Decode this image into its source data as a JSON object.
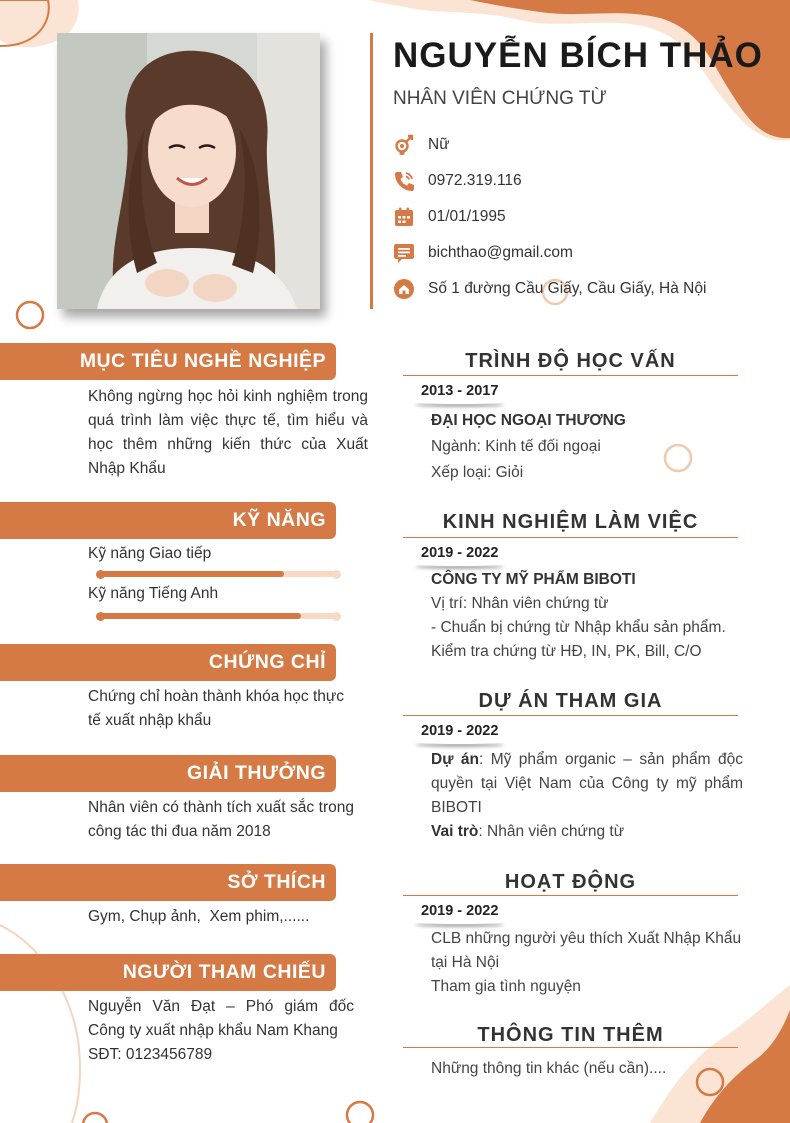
{
  "colors": {
    "accent": "#d67a45",
    "accent_light": "#f7d9c4",
    "text": "#333333"
  },
  "profile": {
    "name": "NGUYỄN BÍCH THẢO",
    "job_title": "NHÂN VIÊN CHỨNG TỪ",
    "gender": "Nữ",
    "phone": "0972.319.116",
    "birthday": "01/01/1995",
    "email": "bichthao@gmail.com",
    "address": "Số 1 đường Cầu Giấy, Cầu Giấy, Hà Nội"
  },
  "icons": [
    "gender-icon",
    "phone-icon",
    "calendar-icon",
    "email-icon",
    "location-icon"
  ],
  "left": {
    "objective": {
      "title": "MỤC TIÊU NGHỀ NGHIỆP",
      "text": "Không ngừng học hỏi kinh nghiệm trong quá trình làm việc thực tế, tìm hiểu và học thêm những kiến thức của Xuất Nhập Khẩu"
    },
    "skills": {
      "title": "KỸ NĂNG",
      "items": [
        {
          "label": "Kỹ năng Giao tiếp",
          "level": 0.78
        },
        {
          "label": "Kỹ năng Tiếng Anh",
          "level": 0.85
        }
      ]
    },
    "certificates": {
      "title": "CHỨNG CHỈ",
      "text": "Chứng chỉ hoàn thành khóa học thực tế xuất nhập khẩu"
    },
    "awards": {
      "title": "GIẢI THƯỞNG",
      "text": "Nhân viên có thành tích xuất sắc trong công tác thi đua năm 2018"
    },
    "hobbies": {
      "title": "SỞ THÍCH",
      "text": "Gym, Chụp ảnh,  Xem phim,......"
    },
    "references": {
      "title": "NGƯỜI THAM CHIẾU",
      "text": "Nguyễn Văn Đạt – Phó giám đốc Công ty xuất nhập khẩu Nam Khang",
      "phone": "SĐT: 0123456789"
    }
  },
  "right": {
    "education": {
      "title": "TRÌNH ĐỘ HỌC VẤN",
      "date": "2013 - 2017",
      "school": "ĐẠI HỌC NGOẠI THƯƠNG",
      "major": "Ngành: Kinh tế đối ngoại",
      "grade": "Xếp loại: Giỏi"
    },
    "experience": {
      "title": "KINH NGHIỆM LÀM VIỆC",
      "date": "2019 - 2022",
      "company": "CÔNG TY MỸ PHẨM BIBOTI",
      "position": "Vị trí: Nhân viên chứng từ",
      "task1": "- Chuẩn bị chứng từ Nhập khẩu sản phẩm.",
      "task2": "Kiểm tra chứng từ HĐ, IN, PK, Bill, C/O"
    },
    "projects": {
      "title": "DỰ ÁN THAM GIA",
      "date": "2019 - 2022",
      "project_label": "Dự án",
      "project_text": ": Mỹ phẩm organic – sản phẩm độc quyền tại Việt Nam của Công ty mỹ phẩm BIBOTI",
      "role_label": "Vai trò",
      "role_text": ": Nhân viên chứng từ"
    },
    "activities": {
      "title": "HOẠT ĐỘNG",
      "date": "2019 - 2022",
      "line1": "CLB những người yêu thích Xuất Nhập Khẩu",
      "line2": "tại Hà Nội",
      "line3": "Tham gia tình nguyện"
    },
    "more_info": {
      "title": "THÔNG TIN THÊM",
      "text": "Những thông tin khác (nếu cần)...."
    }
  }
}
